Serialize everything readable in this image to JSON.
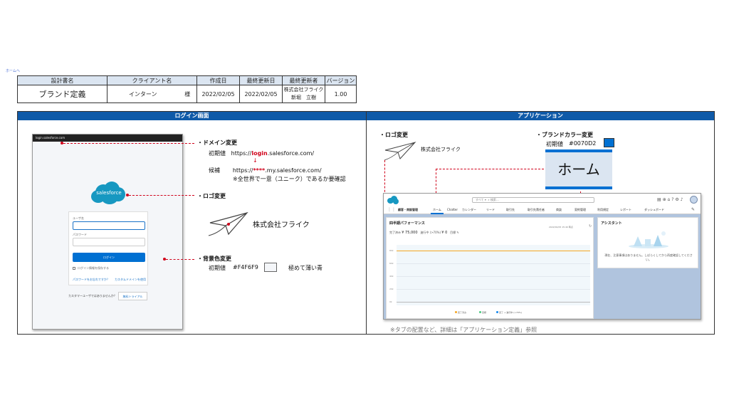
{
  "back_link": "ホームへ",
  "doc_table": {
    "headers": [
      "設計書名",
      "クライアント名",
      "",
      "作成日",
      "最終更新日",
      "最終更新者",
      "バージョン"
    ],
    "row": {
      "doc_name": "ブランド定義",
      "client": "インターン",
      "honorific": "様",
      "created": "2022/02/05",
      "updated": "2022/02/05",
      "updater_company": "株式会社フライク",
      "updater_name": "新堀　立樹",
      "version": "1.00"
    }
  },
  "sections": {
    "login": "ログイン画面",
    "app": "アプリケーション"
  },
  "login_mock": {
    "url": "login.salesforce.com",
    "logo": "salesforce",
    "username_label": "ユーザ名",
    "password_label": "パスワード",
    "login_button": "ログイン",
    "remember": "ログイン情報を保存する",
    "forgot": "パスワードをお忘れですか？",
    "custom_domain": "カスタムドメインを使用",
    "not_customer": "カスタマーユーザではありませんか？",
    "trial": "無料トライアル"
  },
  "notes": {
    "domain": {
      "title": "・ドメイン変更",
      "initial_label": "初期値",
      "initial_prefix": "https://",
      "initial_highlight": "login",
      "initial_suffix": ".salesforce.com/",
      "arrow": "↓",
      "candidate_label": "候補",
      "candidate_prefix": "https://",
      "candidate_highlight": "****",
      "candidate_suffix": ".my.salesforce.com/",
      "candidate_note": "※全世界で一意（ユニーク）であるか要確認"
    },
    "login_logo": {
      "title": "・ロゴ変更",
      "company": "株式会社フライク"
    },
    "bg_color": {
      "title": "・背景色変更",
      "initial_label": "初期値",
      "value": "#F4F6F9",
      "desc": "極めて薄い青"
    },
    "app_logo": {
      "title": "・ロゴ変更",
      "company": "株式会社フライク"
    },
    "brand_color": {
      "title": "・ブランドカラー変更",
      "initial_label": "初期値",
      "value": "#0070D2"
    },
    "home_tab": "ホーム",
    "reference": "※タブの配置など、詳細は「アプリケーション定義」参照"
  },
  "colors": {
    "section_header": "#0f5aa8",
    "annotation": "#d0021b",
    "brand": "#0070d2",
    "login_bg": "#f4f6f9"
  },
  "app_mock": {
    "search_scope": "すべて",
    "search_placeholder": "検索...",
    "app_name": "顧客・商談管理",
    "tabs": [
      "ホーム",
      "Chatter",
      "カレンダー",
      "リード",
      "取引先",
      "取引先責任者",
      "商談",
      "契約管理",
      "利用規定",
      "レポート",
      "ダッシュボード"
    ],
    "perf_title": "四半期パフォーマンス",
    "perf_closed": "完了済み",
    "perf_closed_value": "¥ 75,000",
    "perf_open": "進行中 (>70%)",
    "perf_open_value": "¥ 0",
    "perf_goal": "目標",
    "perf_updated": "2022/02/05 15:40 時点",
    "y_ticks": [
      "80k",
      "60k",
      "40k",
      "20k",
      "0k"
    ],
    "legend": [
      "完了済み",
      "目標",
      "完了 + 進行中 (>70%)"
    ],
    "asst_title": "アシスタント",
    "asst_message": "現在、注意事項はありません。しばらくしてから再度確認してください。"
  }
}
